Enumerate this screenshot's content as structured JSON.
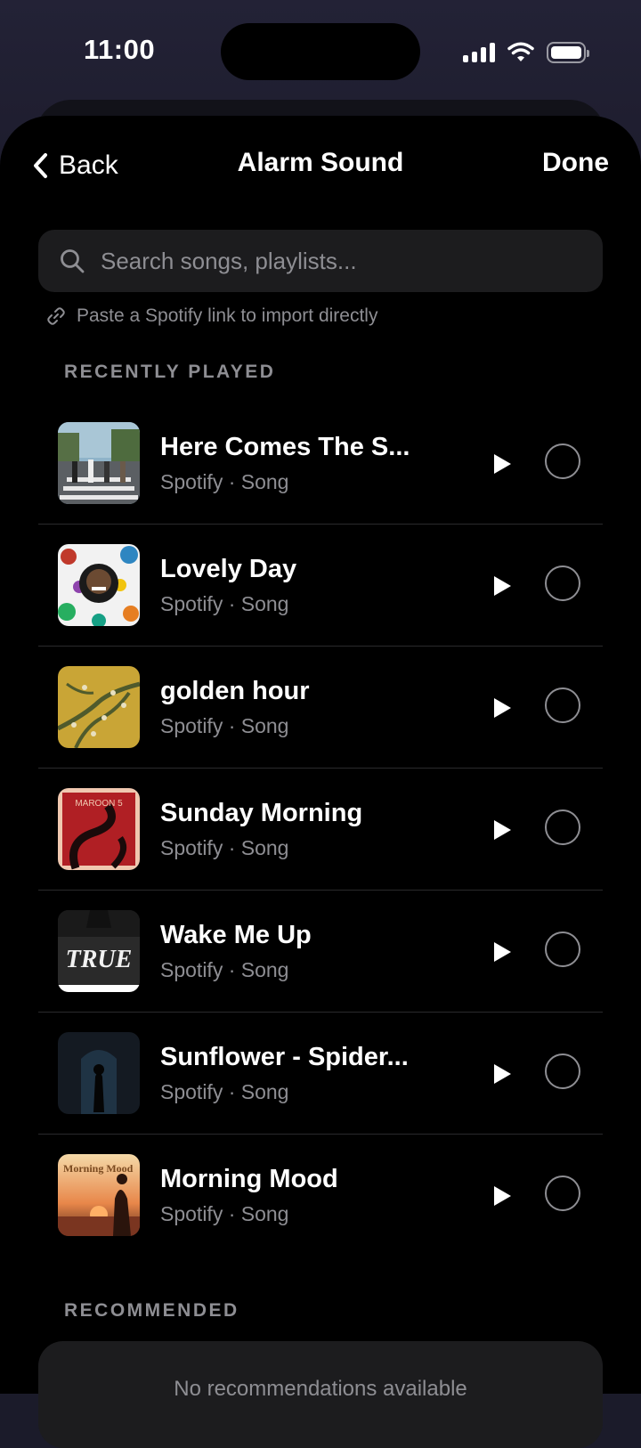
{
  "status_bar": {
    "time": "11:00"
  },
  "nav": {
    "back_label": "Back",
    "title": "Alarm Sound",
    "done_label": "Done"
  },
  "search": {
    "placeholder": "Search songs, playlists..."
  },
  "hint": "Paste a Spotify link to import directly",
  "sections": {
    "recent": "RECENTLY PLAYED",
    "recommended": "RECOMMENDED"
  },
  "songs": [
    {
      "title": "Here Comes The S...",
      "subtitle": "Spotify · Song"
    },
    {
      "title": "Lovely Day",
      "subtitle": "Spotify · Song"
    },
    {
      "title": "golden hour",
      "subtitle": "Spotify · Song"
    },
    {
      "title": "Sunday Morning",
      "subtitle": "Spotify · Song"
    },
    {
      "title": "Wake Me Up",
      "subtitle": "Spotify · Song"
    },
    {
      "title": "Sunflower - Spider...",
      "subtitle": "Spotify · Song"
    },
    {
      "title": "Morning Mood",
      "subtitle": "Spotify · Song"
    }
  ],
  "album_art_text": {
    "sunday_morning": "MAROON 5",
    "wake_me_up": "TRUE",
    "morning_mood": "Morning Mood"
  },
  "recommended": {
    "empty_text": "No recommendations available"
  }
}
